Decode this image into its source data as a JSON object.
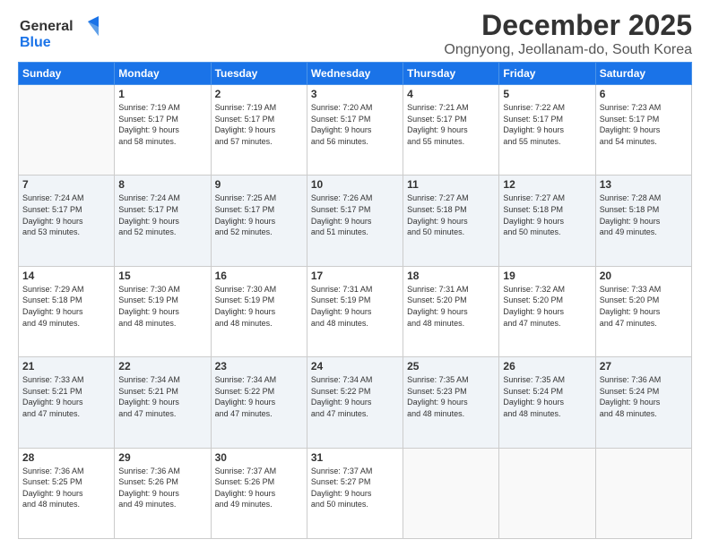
{
  "logo": {
    "line1": "General",
    "line2": "Blue"
  },
  "header": {
    "month": "December 2025",
    "location": "Ongnyong, Jeollanam-do, South Korea"
  },
  "days_of_week": [
    "Sunday",
    "Monday",
    "Tuesday",
    "Wednesday",
    "Thursday",
    "Friday",
    "Saturday"
  ],
  "weeks": [
    [
      {
        "day": "",
        "info": ""
      },
      {
        "day": "1",
        "info": "Sunrise: 7:19 AM\nSunset: 5:17 PM\nDaylight: 9 hours\nand 58 minutes."
      },
      {
        "day": "2",
        "info": "Sunrise: 7:19 AM\nSunset: 5:17 PM\nDaylight: 9 hours\nand 57 minutes."
      },
      {
        "day": "3",
        "info": "Sunrise: 7:20 AM\nSunset: 5:17 PM\nDaylight: 9 hours\nand 56 minutes."
      },
      {
        "day": "4",
        "info": "Sunrise: 7:21 AM\nSunset: 5:17 PM\nDaylight: 9 hours\nand 55 minutes."
      },
      {
        "day": "5",
        "info": "Sunrise: 7:22 AM\nSunset: 5:17 PM\nDaylight: 9 hours\nand 55 minutes."
      },
      {
        "day": "6",
        "info": "Sunrise: 7:23 AM\nSunset: 5:17 PM\nDaylight: 9 hours\nand 54 minutes."
      }
    ],
    [
      {
        "day": "7",
        "info": "Sunrise: 7:24 AM\nSunset: 5:17 PM\nDaylight: 9 hours\nand 53 minutes."
      },
      {
        "day": "8",
        "info": "Sunrise: 7:24 AM\nSunset: 5:17 PM\nDaylight: 9 hours\nand 52 minutes."
      },
      {
        "day": "9",
        "info": "Sunrise: 7:25 AM\nSunset: 5:17 PM\nDaylight: 9 hours\nand 52 minutes."
      },
      {
        "day": "10",
        "info": "Sunrise: 7:26 AM\nSunset: 5:17 PM\nDaylight: 9 hours\nand 51 minutes."
      },
      {
        "day": "11",
        "info": "Sunrise: 7:27 AM\nSunset: 5:18 PM\nDaylight: 9 hours\nand 50 minutes."
      },
      {
        "day": "12",
        "info": "Sunrise: 7:27 AM\nSunset: 5:18 PM\nDaylight: 9 hours\nand 50 minutes."
      },
      {
        "day": "13",
        "info": "Sunrise: 7:28 AM\nSunset: 5:18 PM\nDaylight: 9 hours\nand 49 minutes."
      }
    ],
    [
      {
        "day": "14",
        "info": "Sunrise: 7:29 AM\nSunset: 5:18 PM\nDaylight: 9 hours\nand 49 minutes."
      },
      {
        "day": "15",
        "info": "Sunrise: 7:30 AM\nSunset: 5:19 PM\nDaylight: 9 hours\nand 48 minutes."
      },
      {
        "day": "16",
        "info": "Sunrise: 7:30 AM\nSunset: 5:19 PM\nDaylight: 9 hours\nand 48 minutes."
      },
      {
        "day": "17",
        "info": "Sunrise: 7:31 AM\nSunset: 5:19 PM\nDaylight: 9 hours\nand 48 minutes."
      },
      {
        "day": "18",
        "info": "Sunrise: 7:31 AM\nSunset: 5:20 PM\nDaylight: 9 hours\nand 48 minutes."
      },
      {
        "day": "19",
        "info": "Sunrise: 7:32 AM\nSunset: 5:20 PM\nDaylight: 9 hours\nand 47 minutes."
      },
      {
        "day": "20",
        "info": "Sunrise: 7:33 AM\nSunset: 5:20 PM\nDaylight: 9 hours\nand 47 minutes."
      }
    ],
    [
      {
        "day": "21",
        "info": "Sunrise: 7:33 AM\nSunset: 5:21 PM\nDaylight: 9 hours\nand 47 minutes."
      },
      {
        "day": "22",
        "info": "Sunrise: 7:34 AM\nSunset: 5:21 PM\nDaylight: 9 hours\nand 47 minutes."
      },
      {
        "day": "23",
        "info": "Sunrise: 7:34 AM\nSunset: 5:22 PM\nDaylight: 9 hours\nand 47 minutes."
      },
      {
        "day": "24",
        "info": "Sunrise: 7:34 AM\nSunset: 5:22 PM\nDaylight: 9 hours\nand 47 minutes."
      },
      {
        "day": "25",
        "info": "Sunrise: 7:35 AM\nSunset: 5:23 PM\nDaylight: 9 hours\nand 48 minutes."
      },
      {
        "day": "26",
        "info": "Sunrise: 7:35 AM\nSunset: 5:24 PM\nDaylight: 9 hours\nand 48 minutes."
      },
      {
        "day": "27",
        "info": "Sunrise: 7:36 AM\nSunset: 5:24 PM\nDaylight: 9 hours\nand 48 minutes."
      }
    ],
    [
      {
        "day": "28",
        "info": "Sunrise: 7:36 AM\nSunset: 5:25 PM\nDaylight: 9 hours\nand 48 minutes."
      },
      {
        "day": "29",
        "info": "Sunrise: 7:36 AM\nSunset: 5:26 PM\nDaylight: 9 hours\nand 49 minutes."
      },
      {
        "day": "30",
        "info": "Sunrise: 7:37 AM\nSunset: 5:26 PM\nDaylight: 9 hours\nand 49 minutes."
      },
      {
        "day": "31",
        "info": "Sunrise: 7:37 AM\nSunset: 5:27 PM\nDaylight: 9 hours\nand 50 minutes."
      },
      {
        "day": "",
        "info": ""
      },
      {
        "day": "",
        "info": ""
      },
      {
        "day": "",
        "info": ""
      }
    ]
  ]
}
